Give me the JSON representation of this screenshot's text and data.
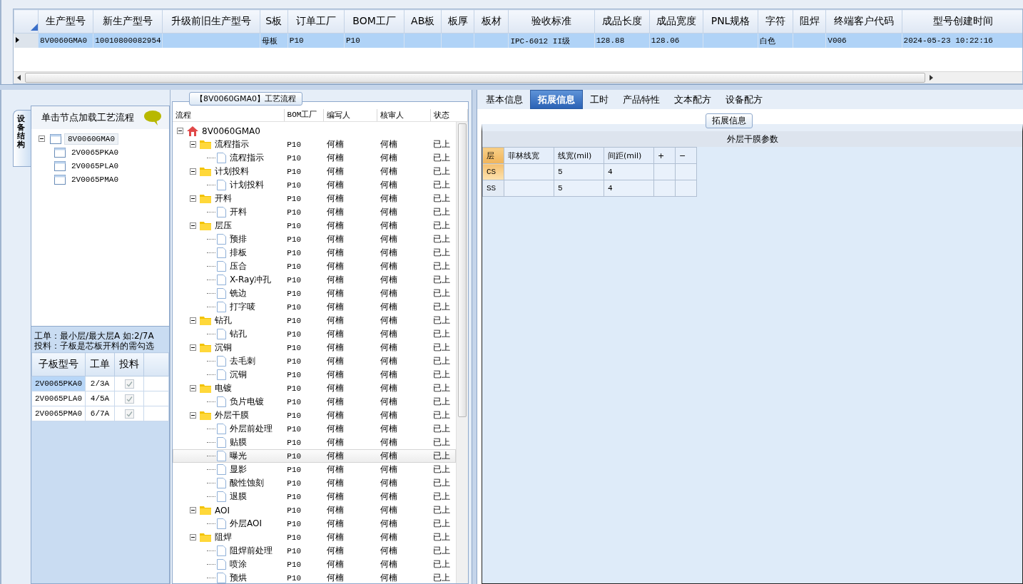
{
  "top_table": {
    "columns": [
      "生产型号",
      "新生产型号",
      "升级前旧生产型号",
      "S板",
      "订单工厂",
      "BOM工厂",
      "AB板",
      "板厚",
      "板材",
      "验收标准",
      "成品长度",
      "成品宽度",
      "PNL规格",
      "字符",
      "阻焊",
      "终端客户代码",
      "型号创建时间"
    ],
    "rows": [
      {
        "selected": true,
        "cells": [
          "8V0060GMA0",
          "10010800082954",
          null,
          "母板",
          "P10",
          "P10",
          null,
          null,
          null,
          "IPC-6012 II级",
          "128.88",
          "128.06",
          null,
          "白色",
          null,
          "V006",
          "2024-05-23 10:22:16"
        ]
      }
    ]
  },
  "side_tab": "设备结构",
  "structure": {
    "hint": "单击节点加载工艺流程",
    "tree": [
      {
        "label": "8V0060GMA0",
        "selected": true,
        "expanded": true,
        "children": [
          {
            "label": "2V0065PKA0",
            "selected": false
          },
          {
            "label": "2V0065PLA0",
            "selected": false
          },
          {
            "label": "2V0065PMA0",
            "selected": false
          }
        ]
      }
    ]
  },
  "note_lines": [
    "工单：最小层/最大层A 如:2/7A",
    "投料：子板是芯板开料的需勾选"
  ],
  "sub_boards": {
    "columns": [
      "子板型号",
      "工单",
      "投料"
    ],
    "rows": [
      {
        "model": "2V0065PKA0",
        "order": "2/3A",
        "feed": true,
        "selected": true
      },
      {
        "model": "2V0065PLA0",
        "order": "4/5A",
        "feed": true,
        "selected": false
      },
      {
        "model": "2V0065PMA0",
        "order": "6/7A",
        "feed": true,
        "selected": false
      }
    ]
  },
  "flow": {
    "title": "【8V0060GMA0】工艺流程",
    "columns": [
      "流程",
      "BOM工厂",
      "编写人",
      "核审人",
      "状态"
    ],
    "root": {
      "label": "8V0060GMA0",
      "expanded": true,
      "selected": false,
      "children": [
        {
          "label": "流程指示",
          "expanded": true,
          "selected": false,
          "bom": "P10",
          "writer": "何楠",
          "reviewer": "何楠",
          "status": "已上",
          "children": [
            {
              "label": "流程指示",
              "selected": false,
              "bom": "P10",
              "writer": "何楠",
              "reviewer": "何楠",
              "status": "已上"
            }
          ]
        },
        {
          "label": "计划投料",
          "expanded": true,
          "selected": false,
          "bom": "P10",
          "writer": "何楠",
          "reviewer": "何楠",
          "status": "已上",
          "children": [
            {
              "label": "计划投料",
              "selected": false,
              "bom": "P10",
              "writer": "何楠",
              "reviewer": "何楠",
              "status": "已上"
            }
          ]
        },
        {
          "label": "开料",
          "expanded": true,
          "selected": false,
          "bom": "P10",
          "writer": "何楠",
          "reviewer": "何楠",
          "status": "已上",
          "children": [
            {
              "label": "开料",
              "selected": false,
              "bom": "P10",
              "writer": "何楠",
              "reviewer": "何楠",
              "status": "已上"
            }
          ]
        },
        {
          "label": "层压",
          "expanded": true,
          "selected": false,
          "bom": "P10",
          "writer": "何楠",
          "reviewer": "何楠",
          "status": "已上",
          "children": [
            {
              "label": "预排",
              "selected": false,
              "bom": "P10",
              "writer": "何楠",
              "reviewer": "何楠",
              "status": "已上"
            },
            {
              "label": "排板",
              "selected": false,
              "bom": "P10",
              "writer": "何楠",
              "reviewer": "何楠",
              "status": "已上"
            },
            {
              "label": "压合",
              "selected": false,
              "bom": "P10",
              "writer": "何楠",
              "reviewer": "何楠",
              "status": "已上"
            },
            {
              "label": "X-Ray冲孔",
              "selected": false,
              "bom": "P10",
              "writer": "何楠",
              "reviewer": "何楠",
              "status": "已上"
            },
            {
              "label": "铣边",
              "selected": false,
              "bom": "P10",
              "writer": "何楠",
              "reviewer": "何楠",
              "status": "已上"
            },
            {
              "label": "打字唛",
              "selected": false,
              "bom": "P10",
              "writer": "何楠",
              "reviewer": "何楠",
              "status": "已上"
            }
          ]
        },
        {
          "label": "钻孔",
          "expanded": true,
          "selected": false,
          "bom": "P10",
          "writer": "何楠",
          "reviewer": "何楠",
          "status": "已上",
          "children": [
            {
              "label": "钻孔",
              "selected": false,
              "bom": "P10",
              "writer": "何楠",
              "reviewer": "何楠",
              "status": "已上"
            }
          ]
        },
        {
          "label": "沉铜",
          "expanded": true,
          "selected": false,
          "bom": "P10",
          "writer": "何楠",
          "reviewer": "何楠",
          "status": "已上",
          "children": [
            {
              "label": "去毛刺",
              "selected": false,
              "bom": "P10",
              "writer": "何楠",
              "reviewer": "何楠",
              "status": "已上"
            },
            {
              "label": "沉铜",
              "selected": false,
              "bom": "P10",
              "writer": "何楠",
              "reviewer": "何楠",
              "status": "已上"
            }
          ]
        },
        {
          "label": "电镀",
          "expanded": true,
          "selected": false,
          "bom": "P10",
          "writer": "何楠",
          "reviewer": "何楠",
          "status": "已上",
          "children": [
            {
              "label": "负片电镀",
              "selected": false,
              "bom": "P10",
              "writer": "何楠",
              "reviewer": "何楠",
              "status": "已上"
            }
          ]
        },
        {
          "label": "外层干膜",
          "expanded": true,
          "selected": false,
          "bom": "P10",
          "writer": "何楠",
          "reviewer": "何楠",
          "status": "已上",
          "children": [
            {
              "label": "外层前处理",
              "selected": false,
              "bom": "P10",
              "writer": "何楠",
              "reviewer": "何楠",
              "status": "已上"
            },
            {
              "label": "贴膜",
              "selected": false,
              "bom": "P10",
              "writer": "何楠",
              "reviewer": "何楠",
              "status": "已上"
            },
            {
              "label": "曝光",
              "selected": true,
              "bom": "P10",
              "writer": "何楠",
              "reviewer": "何楠",
              "status": "已上"
            },
            {
              "label": "显影",
              "selected": false,
              "bom": "P10",
              "writer": "何楠",
              "reviewer": "何楠",
              "status": "已上"
            },
            {
              "label": "酸性蚀刻",
              "selected": false,
              "bom": "P10",
              "writer": "何楠",
              "reviewer": "何楠",
              "status": "已上"
            },
            {
              "label": "退膜",
              "selected": false,
              "bom": "P10",
              "writer": "何楠",
              "reviewer": "何楠",
              "status": "已上"
            }
          ]
        },
        {
          "label": "AOI",
          "expanded": true,
          "selected": false,
          "bom": "P10",
          "writer": "何楠",
          "reviewer": "何楠",
          "status": "已上",
          "children": [
            {
              "label": "外层AOI",
              "selected": false,
              "bom": "P10",
              "writer": "何楠",
              "reviewer": "何楠",
              "status": "已上"
            }
          ]
        },
        {
          "label": "阻焊",
          "expanded": true,
          "selected": false,
          "bom": "P10",
          "writer": "何楠",
          "reviewer": "何楠",
          "status": "已上",
          "children": [
            {
              "label": "阻焊前处理",
              "selected": false,
              "bom": "P10",
              "writer": "何楠",
              "reviewer": "何楠",
              "status": "已上"
            },
            {
              "label": "喷涂",
              "selected": false,
              "bom": "P10",
              "writer": "何楠",
              "reviewer": "何楠",
              "status": "已上"
            },
            {
              "label": "预烘",
              "selected": false,
              "bom": "P10",
              "writer": "何楠",
              "reviewer": "何楠",
              "status": "已上"
            }
          ]
        }
      ]
    }
  },
  "right_tabs": [
    {
      "label": "基本信息",
      "selected": false
    },
    {
      "label": "拓展信息",
      "selected": true
    },
    {
      "label": "工时",
      "selected": false
    },
    {
      "label": "产品特性",
      "selected": false
    },
    {
      "label": "文本配方",
      "selected": false
    },
    {
      "label": "设备配方",
      "selected": false
    }
  ],
  "ext_title": "拓展信息",
  "film": {
    "title": "外层干膜参数",
    "columns": [
      "层",
      "菲林线宽",
      "线宽(mil)",
      "间距(mil)",
      "+",
      "−"
    ],
    "rows": [
      {
        "selected": true,
        "cells": [
          "CS",
          null,
          "5",
          "4",
          null,
          null
        ]
      },
      {
        "selected": false,
        "cells": [
          "SS",
          null,
          "5",
          "4",
          null,
          null
        ]
      }
    ]
  }
}
